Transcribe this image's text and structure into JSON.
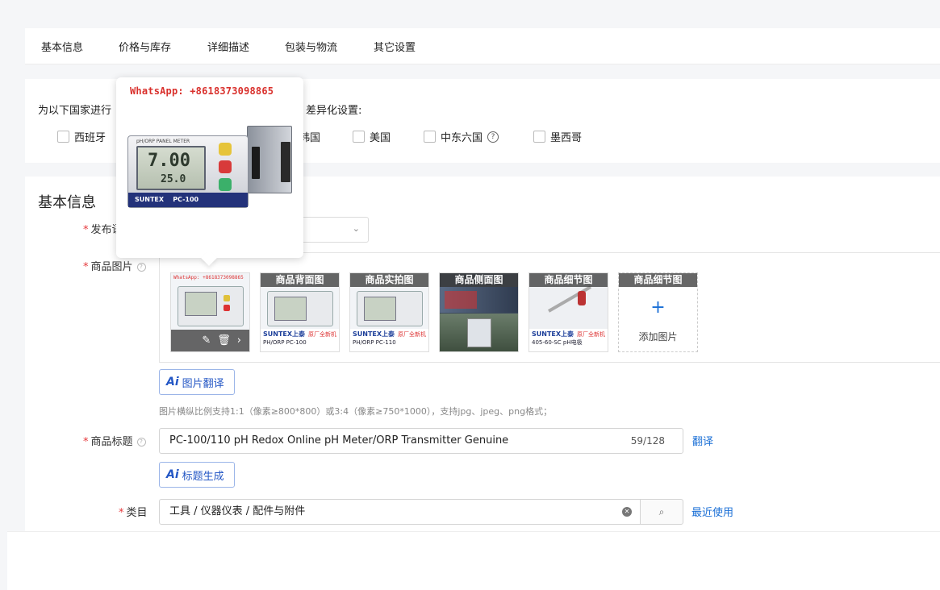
{
  "tabs": [
    "基本信息",
    "价格与库存",
    "详细描述",
    "包装与物流",
    "其它设置"
  ],
  "country_section": {
    "label": "为以下国家进行",
    "label_tail": "差异化设置:",
    "countries": [
      "西班牙",
      "韩国",
      "美国",
      "中东六国",
      "墨西哥"
    ],
    "help_icon": "?"
  },
  "basic": {
    "title": "基本信息",
    "publish_label": "发布语",
    "images_label": "商品图片",
    "thumbs": [
      {
        "caption": "",
        "banner": "WhatsApp: +8618373098865",
        "model": "",
        "tools": true
      },
      {
        "caption": "商品背面图",
        "banner": "",
        "model": "PH/ORP PC-100",
        "tools": false
      },
      {
        "caption": "商品实拍图",
        "banner": "",
        "model": "PH/ORP PC-110",
        "tools": false
      },
      {
        "caption": "商品侧面图",
        "banner": "",
        "model": "",
        "tools": false
      },
      {
        "caption": "商品细节图",
        "banner": "",
        "model": "405-60-SC pH电极",
        "tools": false
      }
    ],
    "add_slot": {
      "caption": "商品细节图",
      "plus": "+",
      "text": "添加图片"
    },
    "brand_name": "SUNTEX",
    "brand_tag": "上泰",
    "brand_note": "原厂全新机",
    "img_translate_btn": "图片翻译",
    "ai_mark": "Ai",
    "img_hint": "图片横纵比例支持1:1（像素≥800*800）或3:4（像素≥750*1000），支持jpg、jpeg、png格式；",
    "title_label": "商品标题",
    "title_value": "PC-100/110 pH Redox Online pH Meter/ORP Transmitter Genuine",
    "title_count": "59/128",
    "translate_link": "翻译",
    "title_gen_btn": "标题生成",
    "category_label": "类目",
    "category_value": "工具 / 仪器仪表 / 配件与附件",
    "recent_link": "最近使用",
    "req_mark": "*"
  },
  "popover": {
    "whatsapp": "WhatsApp: +8618373098865",
    "device_label": "pH/ORP PANEL METER",
    "reading_main": "7.00",
    "reading_sub": "25.0",
    "brand": "SUNTEX",
    "model": "PC-100"
  },
  "colors": {
    "accent": "#1a6fd6",
    "required": "#e5383b",
    "whatsapp": "#d9302c"
  }
}
